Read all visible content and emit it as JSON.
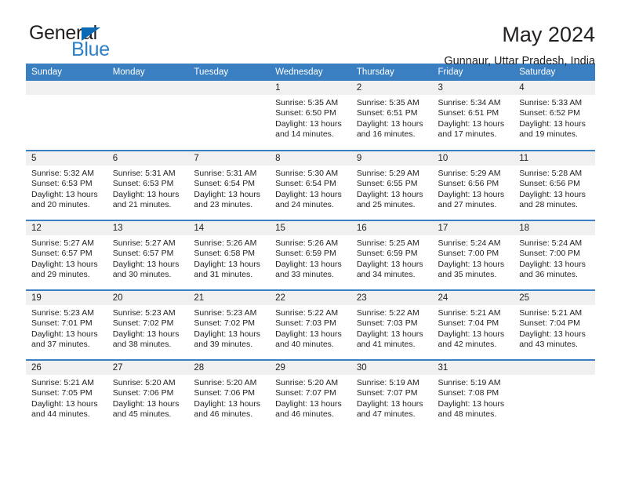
{
  "brand": {
    "name_part1": "General",
    "name_part2": "Blue",
    "triangle_color": "#0a6ab5",
    "blue_color": "#2b80c8"
  },
  "header": {
    "title": "May 2024",
    "subtitle": "Gunnaur, Uttar Pradesh, India"
  },
  "theme": {
    "header_bg": "#3a7fc1",
    "daynum_band_bg": "#f0f0f0",
    "text": "#231f20"
  },
  "weekday_headers": [
    "Sunday",
    "Monday",
    "Tuesday",
    "Wednesday",
    "Thursday",
    "Friday",
    "Saturday"
  ],
  "labels": {
    "sunrise_prefix": "Sunrise: ",
    "sunset_prefix": "Sunset: ",
    "daylight_prefix": "Daylight: "
  },
  "weeks": [
    [
      {
        "day": "",
        "empty": true
      },
      {
        "day": "",
        "empty": true
      },
      {
        "day": "",
        "empty": true
      },
      {
        "day": "1",
        "sunrise": "Sunrise: 5:35 AM",
        "sunset": "Sunset: 6:50 PM",
        "daylight_l1": "Daylight: 13 hours",
        "daylight_l2": "and 14 minutes."
      },
      {
        "day": "2",
        "sunrise": "Sunrise: 5:35 AM",
        "sunset": "Sunset: 6:51 PM",
        "daylight_l1": "Daylight: 13 hours",
        "daylight_l2": "and 16 minutes."
      },
      {
        "day": "3",
        "sunrise": "Sunrise: 5:34 AM",
        "sunset": "Sunset: 6:51 PM",
        "daylight_l1": "Daylight: 13 hours",
        "daylight_l2": "and 17 minutes."
      },
      {
        "day": "4",
        "sunrise": "Sunrise: 5:33 AM",
        "sunset": "Sunset: 6:52 PM",
        "daylight_l1": "Daylight: 13 hours",
        "daylight_l2": "and 19 minutes."
      }
    ],
    [
      {
        "day": "5",
        "sunrise": "Sunrise: 5:32 AM",
        "sunset": "Sunset: 6:53 PM",
        "daylight_l1": "Daylight: 13 hours",
        "daylight_l2": "and 20 minutes."
      },
      {
        "day": "6",
        "sunrise": "Sunrise: 5:31 AM",
        "sunset": "Sunset: 6:53 PM",
        "daylight_l1": "Daylight: 13 hours",
        "daylight_l2": "and 21 minutes."
      },
      {
        "day": "7",
        "sunrise": "Sunrise: 5:31 AM",
        "sunset": "Sunset: 6:54 PM",
        "daylight_l1": "Daylight: 13 hours",
        "daylight_l2": "and 23 minutes."
      },
      {
        "day": "8",
        "sunrise": "Sunrise: 5:30 AM",
        "sunset": "Sunset: 6:54 PM",
        "daylight_l1": "Daylight: 13 hours",
        "daylight_l2": "and 24 minutes."
      },
      {
        "day": "9",
        "sunrise": "Sunrise: 5:29 AM",
        "sunset": "Sunset: 6:55 PM",
        "daylight_l1": "Daylight: 13 hours",
        "daylight_l2": "and 25 minutes."
      },
      {
        "day": "10",
        "sunrise": "Sunrise: 5:29 AM",
        "sunset": "Sunset: 6:56 PM",
        "daylight_l1": "Daylight: 13 hours",
        "daylight_l2": "and 27 minutes."
      },
      {
        "day": "11",
        "sunrise": "Sunrise: 5:28 AM",
        "sunset": "Sunset: 6:56 PM",
        "daylight_l1": "Daylight: 13 hours",
        "daylight_l2": "and 28 minutes."
      }
    ],
    [
      {
        "day": "12",
        "sunrise": "Sunrise: 5:27 AM",
        "sunset": "Sunset: 6:57 PM",
        "daylight_l1": "Daylight: 13 hours",
        "daylight_l2": "and 29 minutes."
      },
      {
        "day": "13",
        "sunrise": "Sunrise: 5:27 AM",
        "sunset": "Sunset: 6:57 PM",
        "daylight_l1": "Daylight: 13 hours",
        "daylight_l2": "and 30 minutes."
      },
      {
        "day": "14",
        "sunrise": "Sunrise: 5:26 AM",
        "sunset": "Sunset: 6:58 PM",
        "daylight_l1": "Daylight: 13 hours",
        "daylight_l2": "and 31 minutes."
      },
      {
        "day": "15",
        "sunrise": "Sunrise: 5:26 AM",
        "sunset": "Sunset: 6:59 PM",
        "daylight_l1": "Daylight: 13 hours",
        "daylight_l2": "and 33 minutes."
      },
      {
        "day": "16",
        "sunrise": "Sunrise: 5:25 AM",
        "sunset": "Sunset: 6:59 PM",
        "daylight_l1": "Daylight: 13 hours",
        "daylight_l2": "and 34 minutes."
      },
      {
        "day": "17",
        "sunrise": "Sunrise: 5:24 AM",
        "sunset": "Sunset: 7:00 PM",
        "daylight_l1": "Daylight: 13 hours",
        "daylight_l2": "and 35 minutes."
      },
      {
        "day": "18",
        "sunrise": "Sunrise: 5:24 AM",
        "sunset": "Sunset: 7:00 PM",
        "daylight_l1": "Daylight: 13 hours",
        "daylight_l2": "and 36 minutes."
      }
    ],
    [
      {
        "day": "19",
        "sunrise": "Sunrise: 5:23 AM",
        "sunset": "Sunset: 7:01 PM",
        "daylight_l1": "Daylight: 13 hours",
        "daylight_l2": "and 37 minutes."
      },
      {
        "day": "20",
        "sunrise": "Sunrise: 5:23 AM",
        "sunset": "Sunset: 7:02 PM",
        "daylight_l1": "Daylight: 13 hours",
        "daylight_l2": "and 38 minutes."
      },
      {
        "day": "21",
        "sunrise": "Sunrise: 5:23 AM",
        "sunset": "Sunset: 7:02 PM",
        "daylight_l1": "Daylight: 13 hours",
        "daylight_l2": "and 39 minutes."
      },
      {
        "day": "22",
        "sunrise": "Sunrise: 5:22 AM",
        "sunset": "Sunset: 7:03 PM",
        "daylight_l1": "Daylight: 13 hours",
        "daylight_l2": "and 40 minutes."
      },
      {
        "day": "23",
        "sunrise": "Sunrise: 5:22 AM",
        "sunset": "Sunset: 7:03 PM",
        "daylight_l1": "Daylight: 13 hours",
        "daylight_l2": "and 41 minutes."
      },
      {
        "day": "24",
        "sunrise": "Sunrise: 5:21 AM",
        "sunset": "Sunset: 7:04 PM",
        "daylight_l1": "Daylight: 13 hours",
        "daylight_l2": "and 42 minutes."
      },
      {
        "day": "25",
        "sunrise": "Sunrise: 5:21 AM",
        "sunset": "Sunset: 7:04 PM",
        "daylight_l1": "Daylight: 13 hours",
        "daylight_l2": "and 43 minutes."
      }
    ],
    [
      {
        "day": "26",
        "sunrise": "Sunrise: 5:21 AM",
        "sunset": "Sunset: 7:05 PM",
        "daylight_l1": "Daylight: 13 hours",
        "daylight_l2": "and 44 minutes."
      },
      {
        "day": "27",
        "sunrise": "Sunrise: 5:20 AM",
        "sunset": "Sunset: 7:06 PM",
        "daylight_l1": "Daylight: 13 hours",
        "daylight_l2": "and 45 minutes."
      },
      {
        "day": "28",
        "sunrise": "Sunrise: 5:20 AM",
        "sunset": "Sunset: 7:06 PM",
        "daylight_l1": "Daylight: 13 hours",
        "daylight_l2": "and 46 minutes."
      },
      {
        "day": "29",
        "sunrise": "Sunrise: 5:20 AM",
        "sunset": "Sunset: 7:07 PM",
        "daylight_l1": "Daylight: 13 hours",
        "daylight_l2": "and 46 minutes."
      },
      {
        "day": "30",
        "sunrise": "Sunrise: 5:19 AM",
        "sunset": "Sunset: 7:07 PM",
        "daylight_l1": "Daylight: 13 hours",
        "daylight_l2": "and 47 minutes."
      },
      {
        "day": "31",
        "sunrise": "Sunrise: 5:19 AM",
        "sunset": "Sunset: 7:08 PM",
        "daylight_l1": "Daylight: 13 hours",
        "daylight_l2": "and 48 minutes."
      },
      {
        "day": "",
        "empty": true
      }
    ]
  ]
}
